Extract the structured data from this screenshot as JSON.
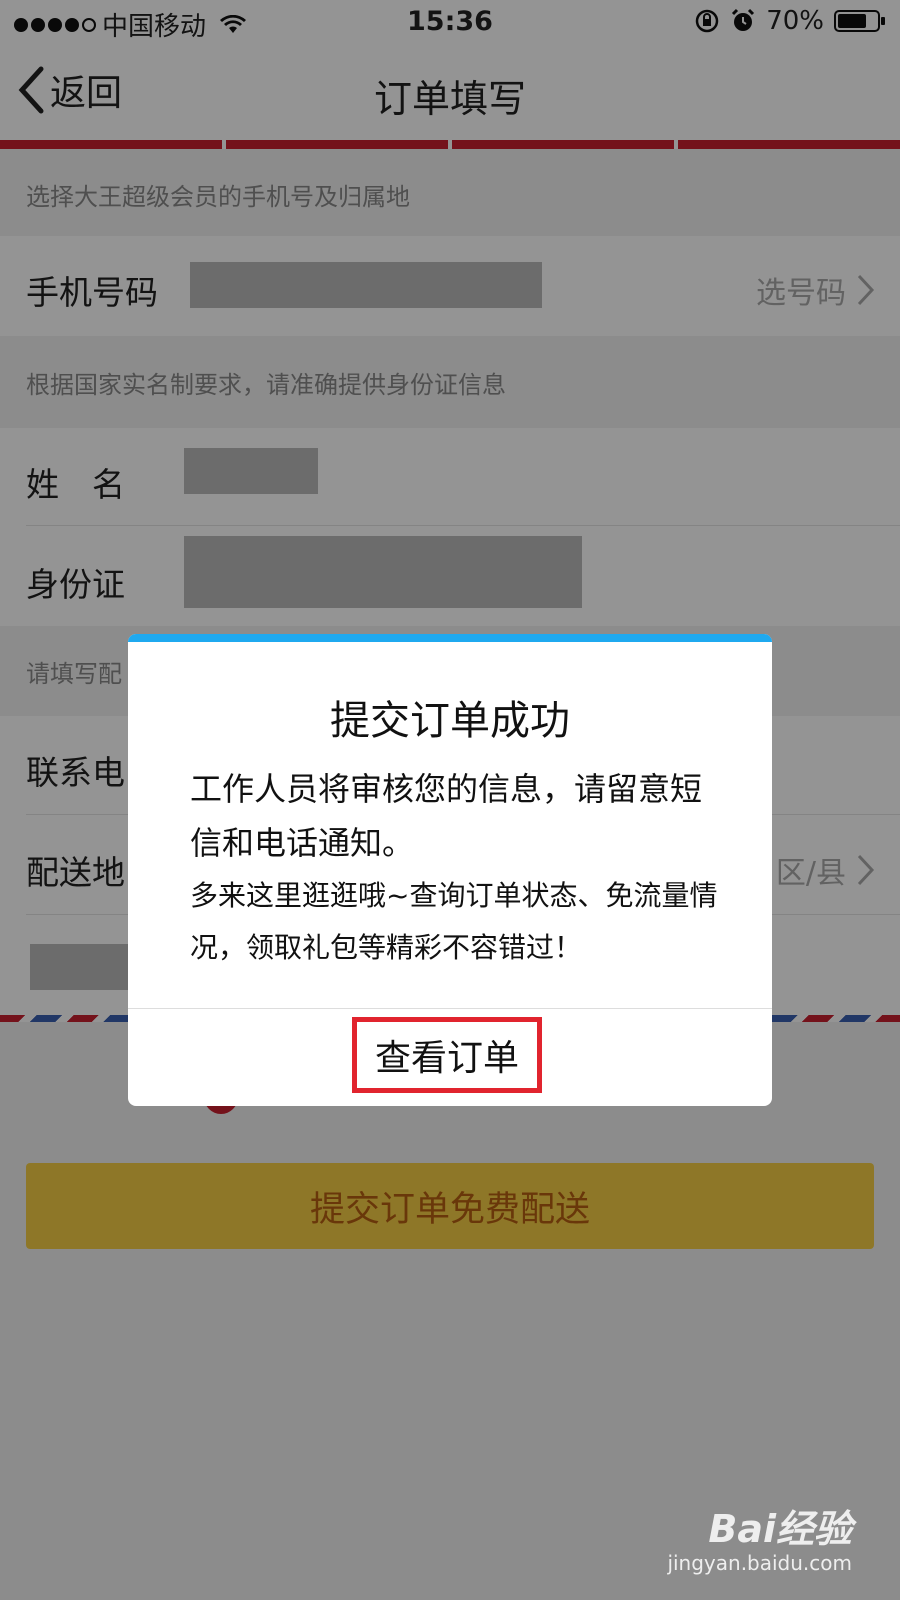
{
  "status_bar": {
    "carrier": "中国移动",
    "time": "15:36",
    "battery": "70%"
  },
  "nav": {
    "back_label": "返回",
    "title": "订单填写"
  },
  "form": {
    "hint_phone": "选择大王超级会员的手机号及归属地",
    "phone_label": "手机号码",
    "phone_action": "选号码",
    "hint_id": "根据国家实名制要求，请准确提供身份证信息",
    "name_label": "姓　名",
    "id_label": "身份证",
    "hint_delivery": "请填写配",
    "contact_label": "联系电",
    "address_label": "配送地",
    "address_action": "区/县"
  },
  "submit_label": "提交订单免费配送",
  "dialog": {
    "title": "提交订单成功",
    "message": "工作人员将审核您的信息，请留意短信和电话通知。",
    "note": "多来这里逛逛哦~查询订单状态、免流量情况，领取礼包等精彩不容错过！",
    "button_label": "查看订单"
  },
  "watermark": {
    "logo": "Bai经验",
    "url": "jingyan.baidu.com"
  },
  "colors": {
    "accent_red": "#c8202f",
    "dialog_top": "#1fa9ef",
    "submit_bg": "#f5ce45"
  }
}
